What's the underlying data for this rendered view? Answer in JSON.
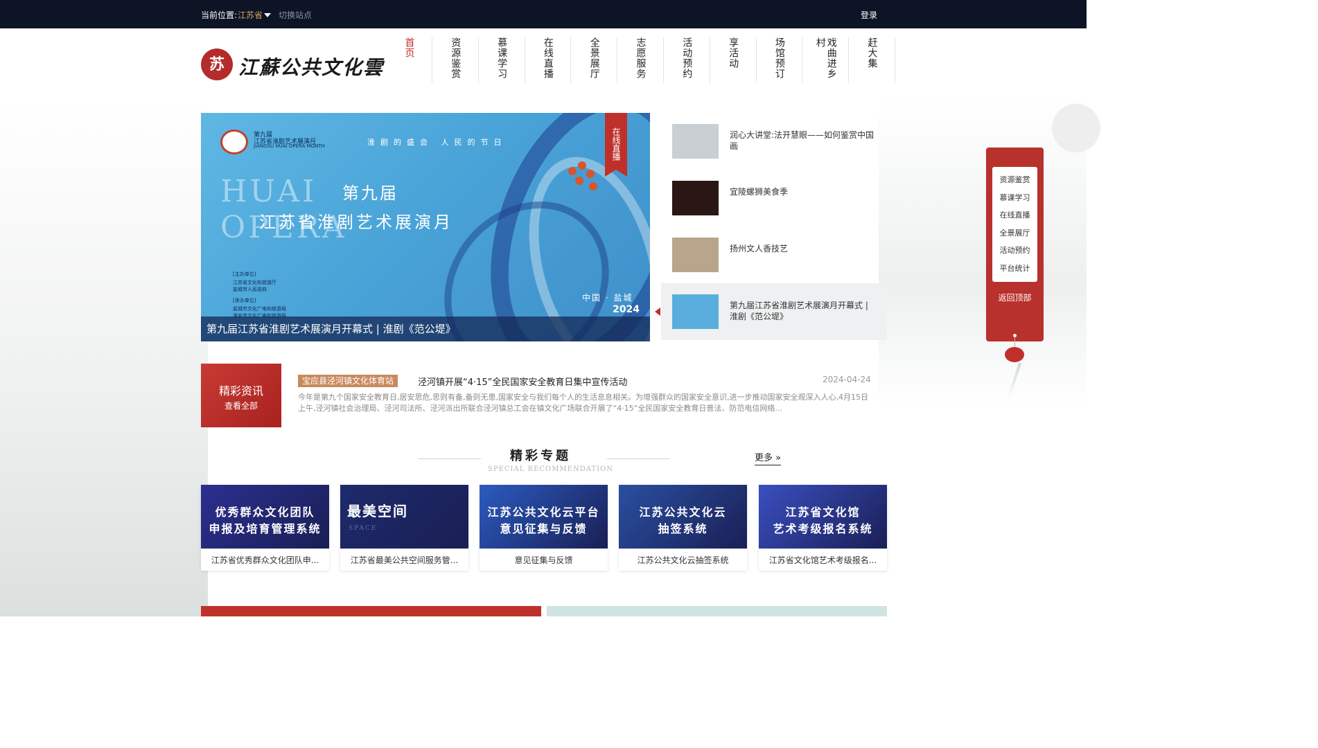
{
  "topbar": {
    "location_label": "当前位置:",
    "location_value": "江苏省",
    "switch_site": "切换站点",
    "login": "登录"
  },
  "logo": {
    "seal": "苏",
    "text": "江蘇公共文化雲"
  },
  "nav": [
    {
      "label": "首页",
      "active": true
    },
    {
      "label": "资源鉴赏",
      "active": false
    },
    {
      "label": "慕课学习",
      "active": false
    },
    {
      "label": "在线直播",
      "active": false
    },
    {
      "label": "全景展厅",
      "active": false
    },
    {
      "label": "志愿服务",
      "active": false
    },
    {
      "label": "活动预约",
      "active": false
    },
    {
      "label": "享活动",
      "active": false
    },
    {
      "label": "场馆预订",
      "active": false
    },
    {
      "label": "戏曲进乡村",
      "active": false
    },
    {
      "label": "赶大集",
      "active": false
    }
  ],
  "banner": {
    "logo_line1": "第九届",
    "logo_line2": "江苏省淮剧艺术展演月",
    "logo_line3": "JIANGSU HUAI OPERA MONTH",
    "slogan": "淮剧的盛会 人民的节日",
    "huai": "HUAI",
    "opera": "OPERA",
    "edition": "第九届",
    "title": "江苏省淮剧艺术展演月",
    "org_line1": "[主办单位]",
    "org_line2": "江苏省文化和旅游厅",
    "org_line3": "盐城市人民政府",
    "org_line4": "[承办单位]",
    "org_line5": "盐城市文化广电和旅游局",
    "org_line6": "淮安市文化广电和旅游局",
    "place": "中国 · 盐城",
    "year": "2024",
    "live_tag": "在线直播",
    "caption": "第九届江苏省淮剧艺术展演月开幕式 | 淮剧《范公堤》"
  },
  "side_list": [
    {
      "title": "润心大讲堂:法开慧眼——如何鉴赏中国画",
      "thumb_color": "#c9cfd2",
      "active": false
    },
    {
      "title": "宜陵螺狮美食季",
      "thumb_color": "#2a1612",
      "active": false
    },
    {
      "title": "扬州文人香技艺",
      "thumb_color": "#b8a58a",
      "active": false
    },
    {
      "title": "第九届江苏省淮剧艺术展演月开幕式 | 淮剧《范公堤》",
      "thumb_color": "#5aaede",
      "active": true
    }
  ],
  "news": {
    "badge_title": "精彩资讯",
    "badge_sub": "查看全部",
    "tag": "宝应县泾河镇文化体育站",
    "title": "泾河镇开展“4·15”全民国家安全教育日集中宣传活动",
    "date": "2024-04-24",
    "summary": "今年是第九个国家安全教育日,居安思危,思则有备,备则无患,国家安全与我们每个人的生活息息相关。为增强群众的国家安全意识,进一步推动国家安全观深入人心,4月15日上午,泾河镇社会治理局、泾河司法所、泾河派出所联合泾河镇总工会在镇文化广场联合开展了“4·15”全民国家安全教育日普法、防范电信网络..."
  },
  "topics": {
    "title": "精彩专题",
    "subtitle": "SPECIAL RECOMMENDATION",
    "more": "更多 »"
  },
  "cards": [
    {
      "image_text_1": "优秀群众文化团队",
      "image_text_2": "申报及培育管理系统",
      "label": "江苏省优秀群众文化团队申...",
      "bg": "#2c2f8f"
    },
    {
      "image_text_1": "最美空间",
      "image_text_2": "SPACE",
      "label": "江苏省最美公共空间服务管...",
      "bg": "#1e2a6b"
    },
    {
      "image_text_1": "江苏公共文化云平台",
      "image_text_2": "意见征集与反馈",
      "label": "意见征集与反馈",
      "bg": "#2b5bbf"
    },
    {
      "image_text_1": "江苏公共文化云",
      "image_text_2": "抽签系统",
      "label": "江苏公共文化云抽签系统",
      "bg": "#2a4fa0"
    },
    {
      "image_text_1": "江苏省文化馆",
      "image_text_2": "艺术考级报名系统",
      "label": "江苏省文化馆艺术考级报名...",
      "bg": "#3a4fc0"
    }
  ],
  "float_panel": {
    "items": [
      "资源鉴赏",
      "慕课学习",
      "在线直播",
      "全景展厅",
      "活动预约",
      "平台统计"
    ],
    "back_top": "返回顶部"
  },
  "colors": {
    "brand_red": "#c0302a",
    "topbar_bg": "#0c1426",
    "accent_gold": "#d9a35a",
    "tag_bg": "#c98a5f"
  }
}
